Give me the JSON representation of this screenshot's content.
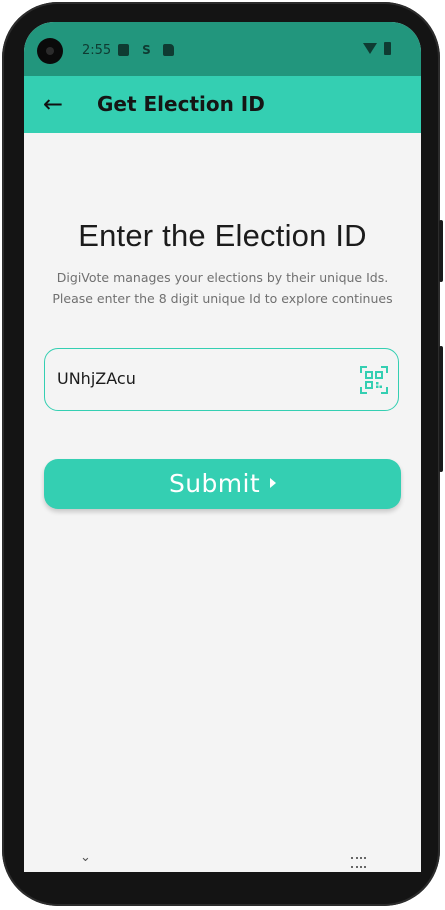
{
  "status_bar": {
    "time": "2:55",
    "icons": [
      "text-a-icon",
      "s-icon",
      "sd-card-icon",
      "wifi-icon",
      "battery-icon"
    ]
  },
  "app_bar": {
    "back_icon": "arrow-left-icon",
    "title": "Get Election ID",
    "color": "#34cfb2"
  },
  "main": {
    "heading": "Enter the Election ID",
    "description_line1": "DigiVote manages your elections by their unique Ids.",
    "description_line2": "Please enter the 8 digit unique Id to explore continues"
  },
  "election_id_field": {
    "value": "UNhjZAcu",
    "scan_icon": "qr-scan-icon"
  },
  "submit": {
    "label": "Submit",
    "arrow_icon": "chevron-right-icon"
  },
  "system_nav": {
    "left_icon": "chevron-down-icon",
    "right_icon": "keyboard-icon"
  }
}
